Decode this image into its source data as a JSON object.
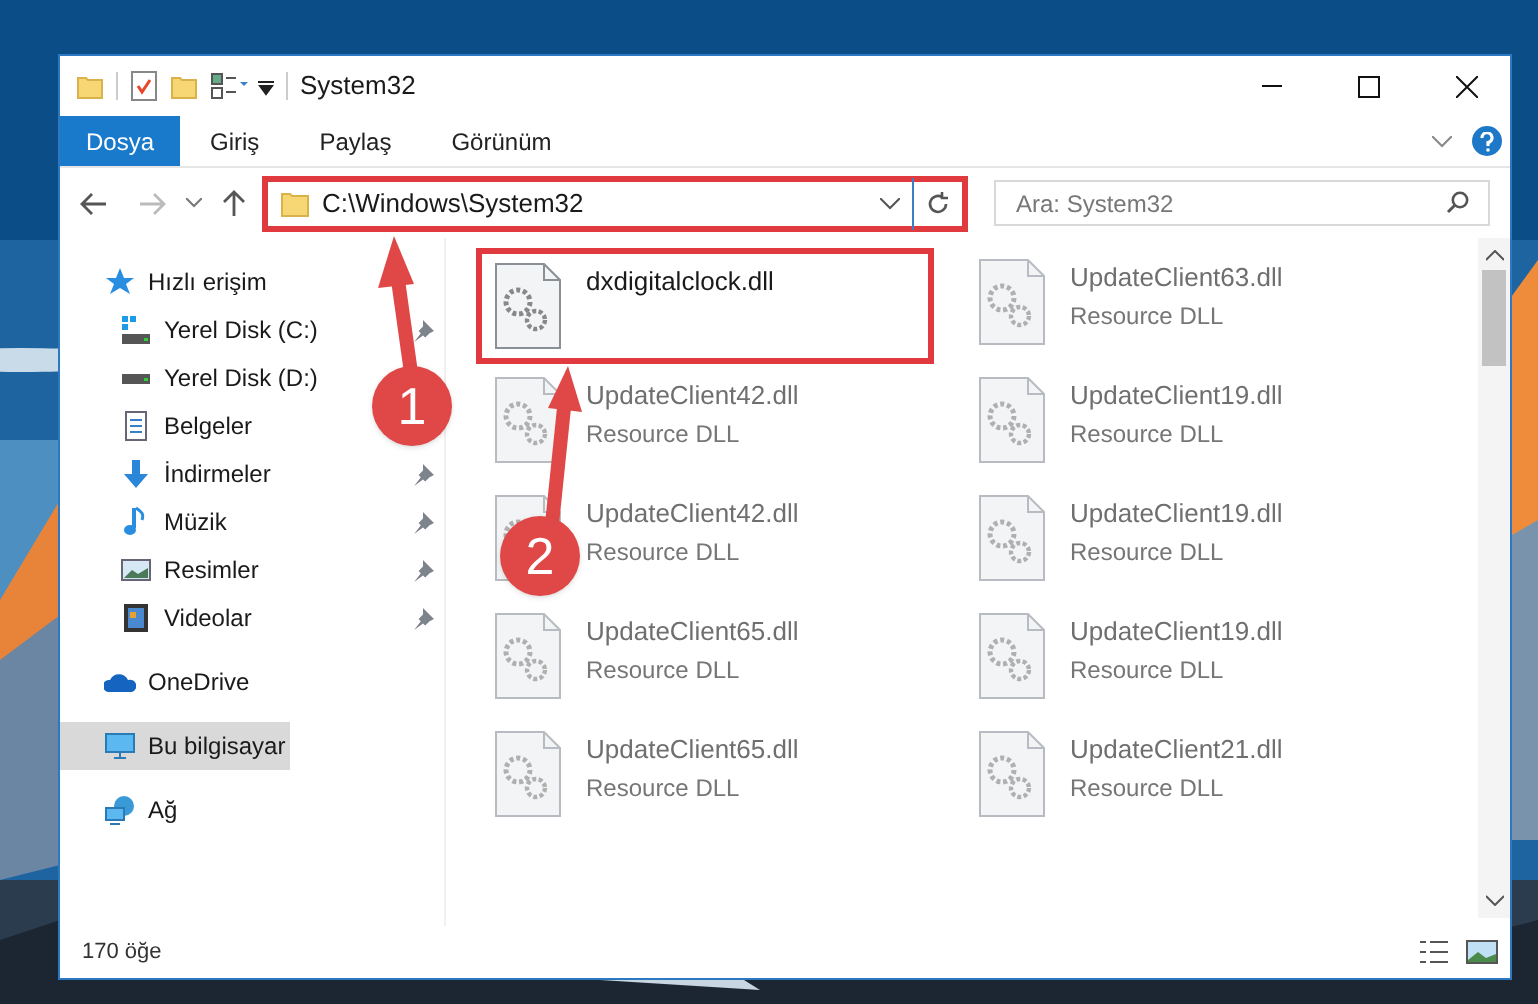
{
  "window": {
    "title": "System32"
  },
  "ribbon_tabs": [
    {
      "label": "Dosya",
      "selected": true
    },
    {
      "label": "Giriş",
      "selected": false
    },
    {
      "label": "Paylaş",
      "selected": false
    },
    {
      "label": "Görünüm",
      "selected": false
    }
  ],
  "address_bar": {
    "path": "C:\\Windows\\System32",
    "highlighted": true
  },
  "search": {
    "placeholder": "Ara: System32"
  },
  "sidebar": {
    "items": [
      {
        "label": "Hızlı erişim",
        "kind": "star",
        "selected": false,
        "children": [
          {
            "label": "Yerel Disk (C:)",
            "kind": "drive-win",
            "pinned": true,
            "selected": false
          },
          {
            "label": "Yerel Disk (D:)",
            "kind": "drive",
            "pinned": false,
            "selected": false
          },
          {
            "label": "Belgeler",
            "kind": "docs",
            "pinned": false,
            "selected": false
          },
          {
            "label": "İndirmeler",
            "kind": "download",
            "pinned": true,
            "selected": false
          },
          {
            "label": "Müzik",
            "kind": "music",
            "pinned": true,
            "selected": false
          },
          {
            "label": "Resimler",
            "kind": "pictures",
            "pinned": true,
            "selected": false
          },
          {
            "label": "Videolar",
            "kind": "videos",
            "pinned": true,
            "selected": false
          }
        ]
      },
      {
        "label": "OneDrive",
        "kind": "cloud",
        "selected": false
      },
      {
        "label": "Bu bilgisayar",
        "kind": "pc",
        "selected": true
      },
      {
        "label": "Ağ",
        "kind": "network",
        "selected": false
      }
    ]
  },
  "files": [
    {
      "name": "dxdigitalclock.dll",
      "faded": false,
      "highlighted": true
    },
    {
      "name": "UpdateClient63.dll",
      "type": "Resource DLL",
      "faded": true,
      "highlighted": false
    },
    {
      "name": "UpdateClient42.dll",
      "type": "Resource DLL",
      "faded": true,
      "highlighted": false
    },
    {
      "name": "UpdateClient19.dll",
      "type": "Resource DLL",
      "faded": true,
      "highlighted": false
    },
    {
      "name": "UpdateClient42.dll",
      "type": "Resource DLL",
      "faded": true,
      "highlighted": false
    },
    {
      "name": "UpdateClient19.dll",
      "type": "Resource DLL",
      "faded": true,
      "highlighted": false
    },
    {
      "name": "UpdateClient65.dll",
      "type": "Resource DLL",
      "faded": true,
      "highlighted": false
    },
    {
      "name": "UpdateClient19.dll",
      "type": "Resource DLL",
      "faded": true,
      "highlighted": false
    },
    {
      "name": "UpdateClient65.dll",
      "type": "Resource DLL",
      "faded": true,
      "highlighted": false
    },
    {
      "name": "UpdateClient21.dll",
      "type": "Resource DLL",
      "faded": true,
      "highlighted": false
    }
  ],
  "status_bar": {
    "count": "170 öğe"
  },
  "annotations": [
    {
      "label": "1"
    },
    {
      "label": "2"
    }
  ]
}
